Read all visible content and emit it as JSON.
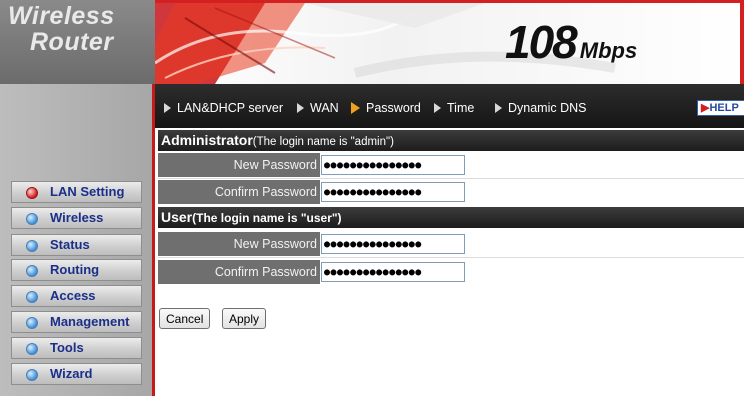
{
  "brand": {
    "line1": "Wireless",
    "line2": "Router",
    "speed_value": "108",
    "speed_unit": "Mbps"
  },
  "nav": {
    "links": [
      {
        "label": "LAN&DHCP server"
      },
      {
        "label": "WAN"
      },
      {
        "label": "Password"
      },
      {
        "label": "Time"
      },
      {
        "label": "Dynamic DNS"
      }
    ],
    "current": "Password",
    "help_label": "HELP"
  },
  "sidebar": {
    "items": [
      {
        "label": "LAN Setting",
        "active": true
      },
      {
        "label": "Wireless"
      },
      {
        "label": "Status"
      },
      {
        "label": "Routing"
      },
      {
        "label": "Access"
      },
      {
        "label": "Management"
      },
      {
        "label": "Tools"
      },
      {
        "label": "Wizard"
      }
    ]
  },
  "admin": {
    "title": "Administrator",
    "subtitle": "(The login name is \"admin\")",
    "new_password_label": "New Password",
    "new_password_value": "●●●●●●●●●●●●●●●",
    "confirm_password_label": "Confirm Password",
    "confirm_password_value": "●●●●●●●●●●●●●●●"
  },
  "user": {
    "title": "User",
    "subtitle": "(The login name is \"user\")",
    "new_password_label": "New Password",
    "new_password_value": "●●●●●●●●●●●●●●●",
    "confirm_password_label": "Confirm Password",
    "confirm_password_value": "●●●●●●●●●●●●●●●"
  },
  "buttons": {
    "cancel": "Cancel",
    "apply": "Apply"
  },
  "colors": {
    "accent_red": "#d42020",
    "nav_bg": "#1c1c1c",
    "menu_text": "#1a2f8a",
    "label_bg": "#6f6f6f"
  }
}
